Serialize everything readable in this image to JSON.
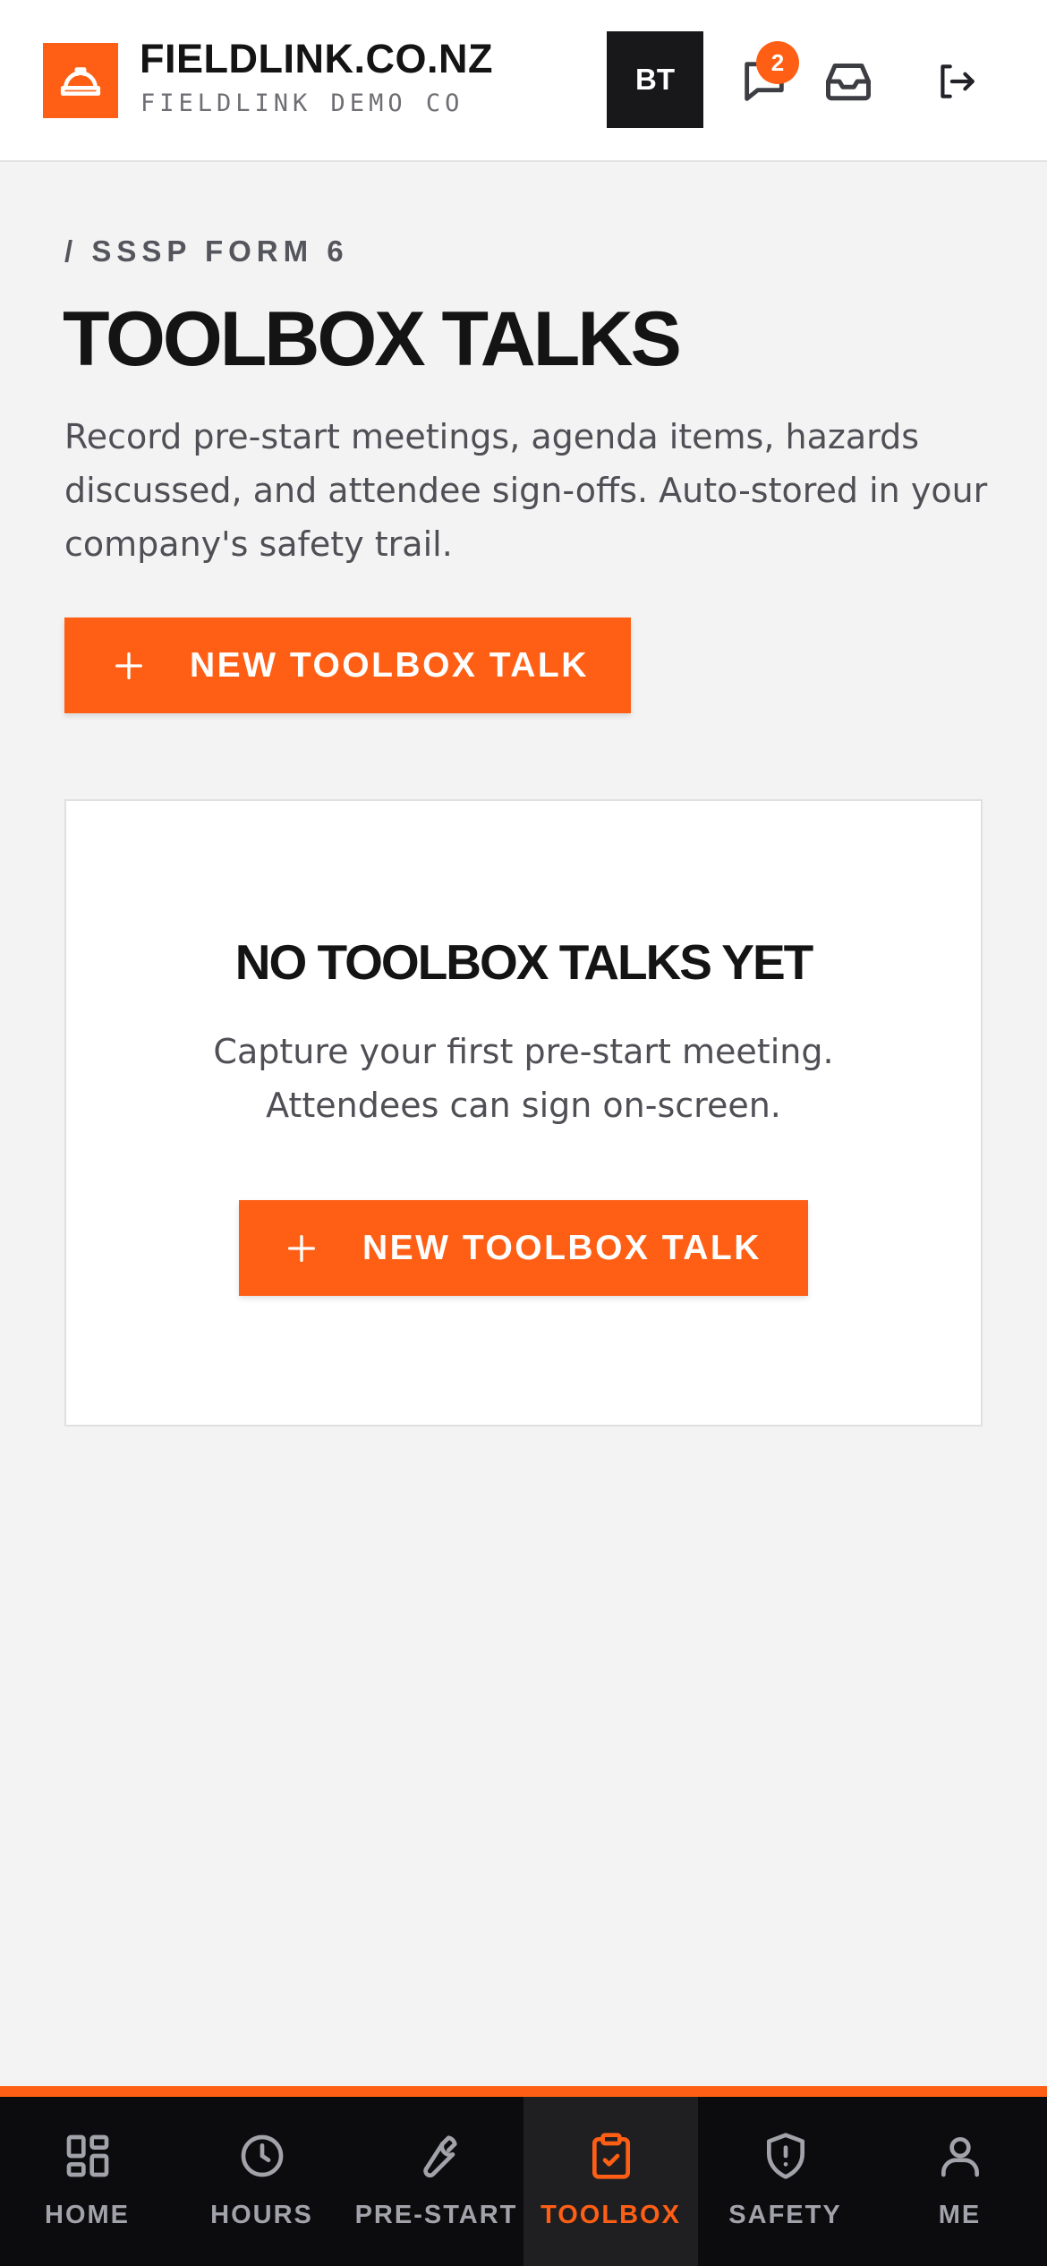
{
  "header": {
    "brand_name": "FIELDLINK.CO.NZ",
    "brand_sub": "FIELDLINK DEMO CO",
    "avatar_initials": "BT",
    "messages_badge": "2",
    "icons": [
      "hardhat-icon",
      "chat-icon",
      "inbox-icon",
      "logout-icon"
    ]
  },
  "page": {
    "breadcrumb": "/ SSSP FORM 6",
    "title": "TOOLBOX TALKS",
    "description": "Record pre-start meetings, agenda items, hazards discussed, and attendee sign-offs. Auto-stored in your company's safety trail.",
    "primary_button": "NEW TOOLBOX TALK"
  },
  "empty_state": {
    "title": "NO TOOLBOX TALKS YET",
    "line1": "Capture your first pre-start meeting.",
    "line2": "Attendees can sign on-screen.",
    "button": "NEW TOOLBOX TALK"
  },
  "nav": {
    "active": "toolbox",
    "items": [
      {
        "label": "HOME",
        "icon": "grid-icon"
      },
      {
        "label": "HOURS",
        "icon": "clock-icon"
      },
      {
        "label": "PRE-START",
        "icon": "wrench-icon"
      },
      {
        "label": "TOOLBOX",
        "icon": "clipboard-check-icon"
      },
      {
        "label": "SAFETY",
        "icon": "shield-alert-icon"
      },
      {
        "label": "ME",
        "icon": "user-icon"
      }
    ]
  },
  "colors": {
    "accent": "#ff5f14",
    "header_bg": "#ffffff",
    "page_bg": "#f3f3f3",
    "nav_bg": "#0c0c0e",
    "avatar_bg": "#18181b"
  }
}
